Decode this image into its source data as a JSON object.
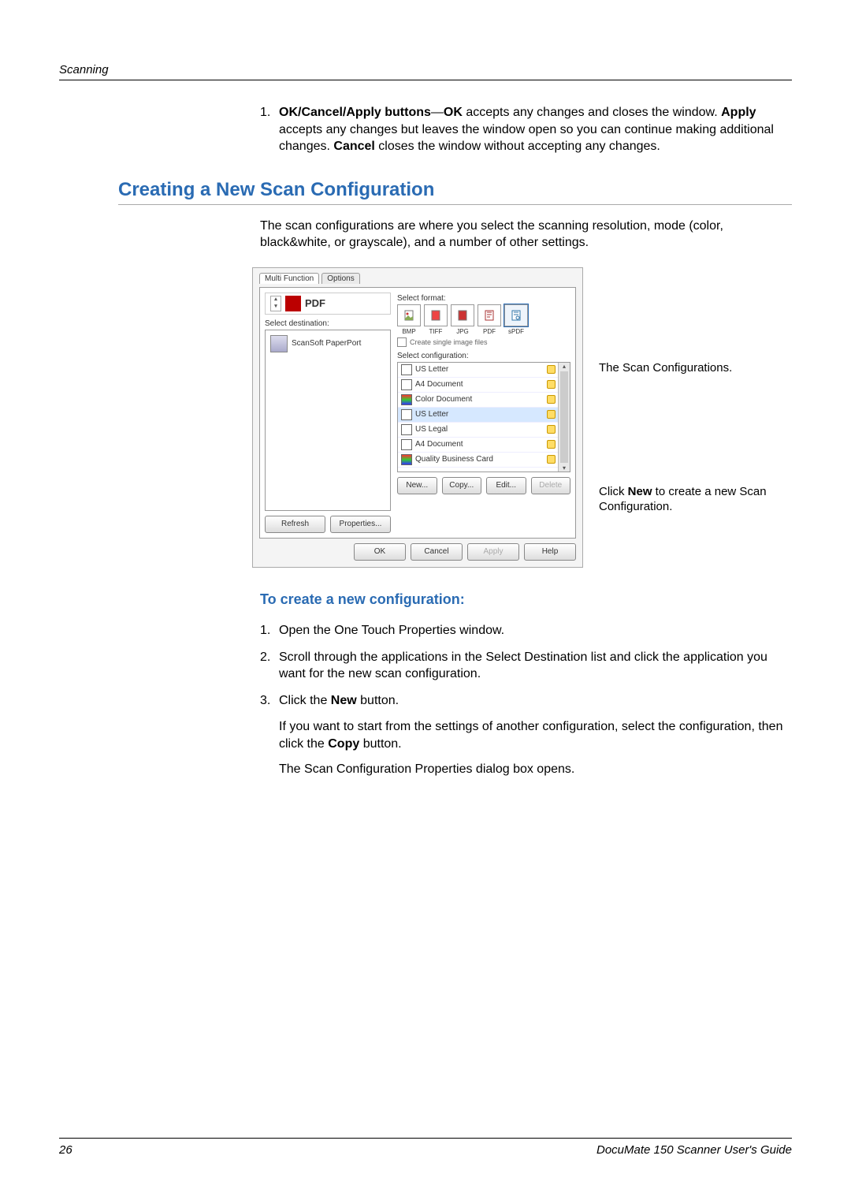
{
  "header": {
    "section_label": "Scanning"
  },
  "item1": {
    "num": "1.",
    "bold1": "OK/Cancel/Apply buttons",
    "dash": "—",
    "bold2": "OK",
    "t1": " accepts any changes and closes the window. ",
    "bold3": "Apply",
    "t2": " accepts any changes but leaves the window open so you can continue making additional changes. ",
    "bold4": "Cancel",
    "t3": " closes the window without accepting any changes."
  },
  "heading": "Creating a New Scan Configuration",
  "intro": "The scan configurations are where you select the scanning resolution, mode (color, black&white, or grayscale), and a number of other settings.",
  "shot": {
    "tab_active": "Multi Function",
    "tab_other": "Options",
    "pdf_label": "PDF",
    "dest_label": "Select destination:",
    "dest_item": "ScanSoft PaperPort",
    "fmt_label": "Select format:",
    "fmt": {
      "bmp": "BMP",
      "tiff": "TIFF",
      "jpg": "JPG",
      "pdf": "PDF",
      "spdf": "sPDF"
    },
    "chk_label": "Create single image files",
    "cfg_label": "Select configuration:",
    "cfg_items": [
      "US Letter",
      "A4 Document",
      "Color Document",
      "US Letter",
      "US Legal",
      "A4 Document",
      "Quality Business Card"
    ],
    "btn_refresh": "Refresh",
    "btn_props": "Properties...",
    "btn_new": "New...",
    "btn_copy": "Copy...",
    "btn_edit": "Edit...",
    "btn_delete": "Delete",
    "btn_ok": "OK",
    "btn_cancel": "Cancel",
    "btn_apply": "Apply",
    "btn_help": "Help"
  },
  "ann": {
    "top": "The Scan Configurations.",
    "bot1": "Click ",
    "bot_bold": "New",
    "bot2": " to create a new Scan Configuration."
  },
  "subheading": "To create a new configuration:",
  "steps": {
    "s1n": "1.",
    "s1": "Open the One Touch Properties window.",
    "s2n": "2.",
    "s2": "Scroll through the applications in the Select Destination list and click the application you want for the new scan configuration.",
    "s3n": "3.",
    "s3a": "Click the ",
    "s3b": "New",
    "s3c": " button.",
    "s3note1a": "If you want to start from the settings of another configuration, select the configuration, then click the ",
    "s3note1b": "Copy",
    "s3note1c": " button.",
    "s3note2": "The Scan Configuration Properties dialog box opens."
  },
  "footer": {
    "page": "26",
    "title": "DocuMate 150 Scanner User's Guide"
  }
}
